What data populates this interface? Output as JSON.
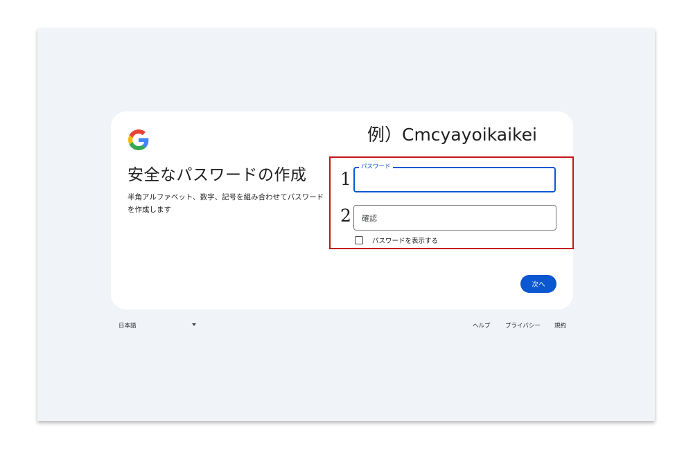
{
  "header": {
    "logo_icon": "google-g-logo",
    "title": "安全なパスワードの作成",
    "description": "半角アルファベット、数字、記号を組み合わせてパスワードを作成します"
  },
  "annotation": {
    "example_text": "例）Cmcyayoikaikei",
    "marker_1": "1",
    "marker_2": "2",
    "highlight_color": "#c4141a"
  },
  "form": {
    "password_label": "パスワード",
    "password_value": "",
    "confirm_placeholder": "確認",
    "confirm_value": "",
    "show_password_label": "パスワードを表示する",
    "show_password_checked": false,
    "next_label": "次へ"
  },
  "footer": {
    "language": "日本語",
    "help": "ヘルプ",
    "privacy": "プライバシー",
    "terms": "規約"
  },
  "colors": {
    "accent": "#0b57d0",
    "background": "#f0f4f9",
    "card": "#ffffff"
  }
}
